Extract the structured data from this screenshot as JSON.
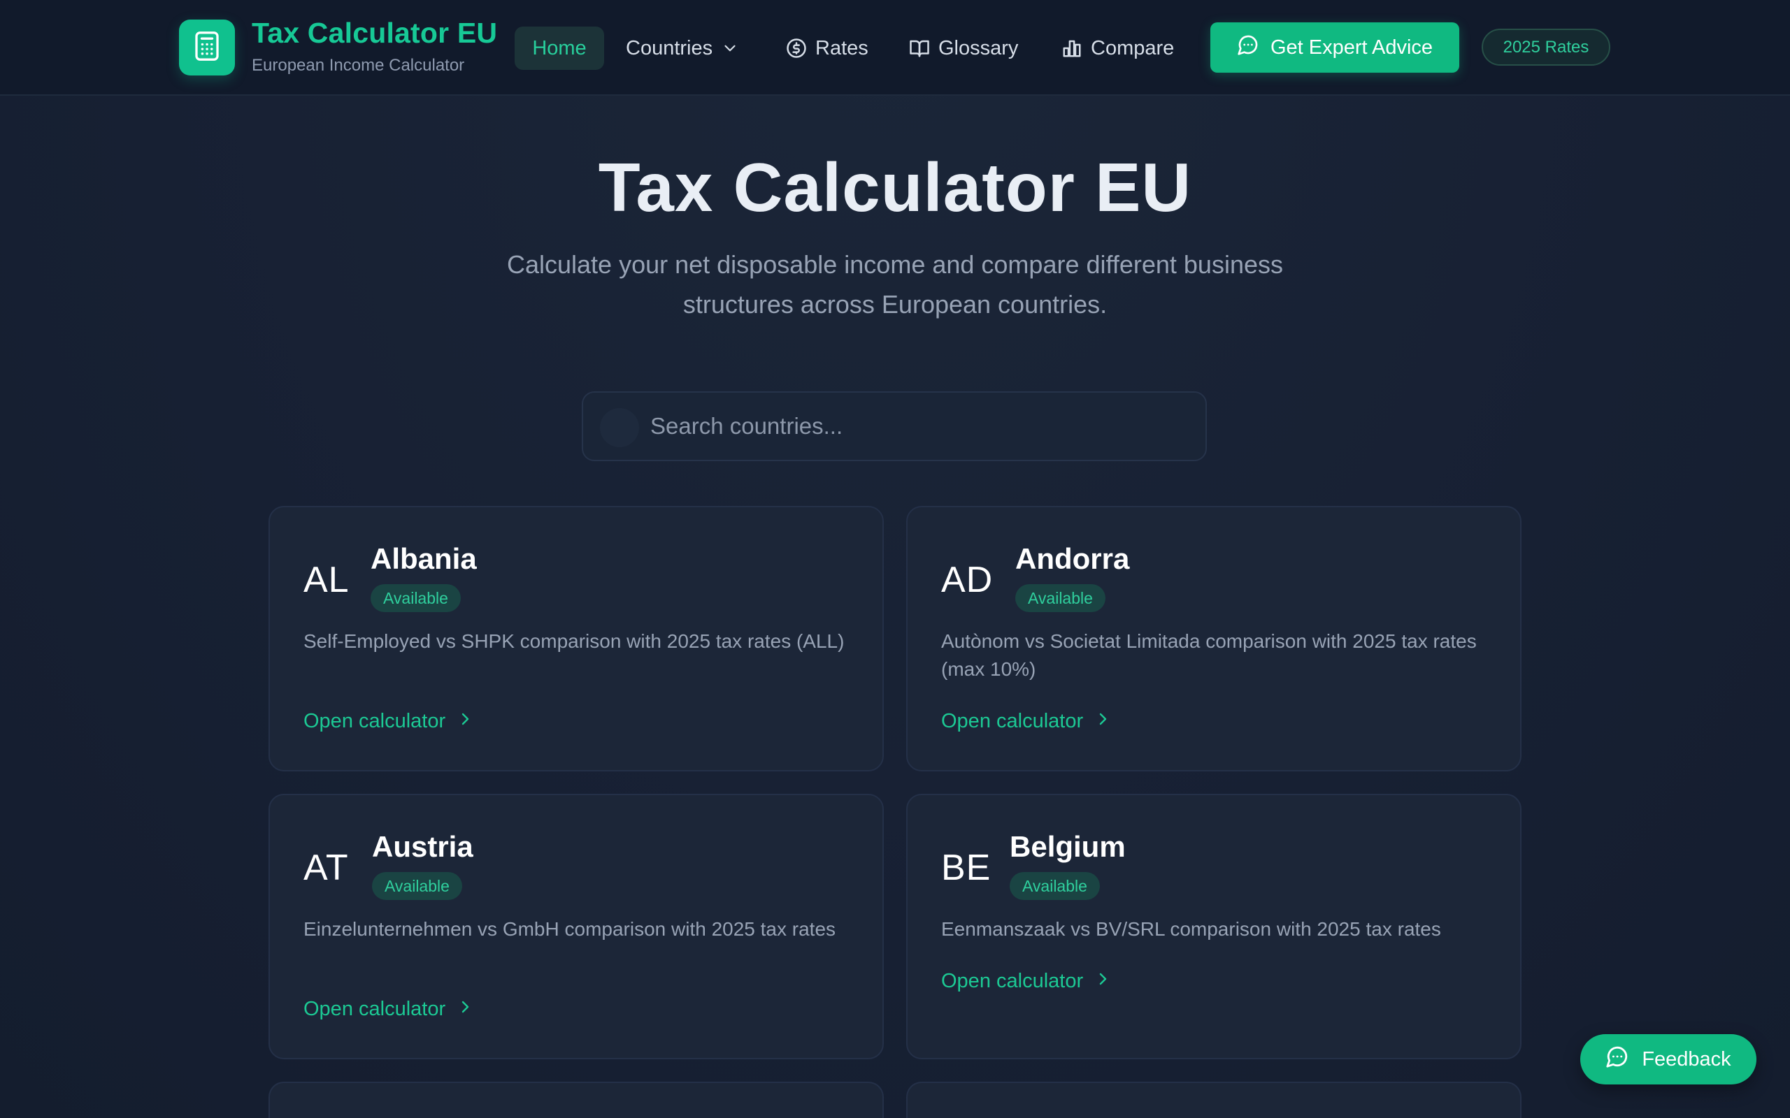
{
  "header": {
    "brand_title": "Tax Calculator EU",
    "brand_subtitle": "European Income Calculator",
    "nav": {
      "home": "Home",
      "countries": "Countries",
      "rates": "Rates",
      "glossary": "Glossary",
      "compare": "Compare"
    },
    "cta_label": "Get Expert Advice",
    "rates_badge": "2025 Rates"
  },
  "hero": {
    "title": "Tax Calculator EU",
    "subtitle": "Calculate your net disposable income and compare different business structures across European countries."
  },
  "search": {
    "placeholder": "Search countries..."
  },
  "countries": [
    {
      "code": "AL",
      "name": "Albania",
      "status": "Available",
      "description": "Self-Employed vs SHPK comparison with 2025 tax rates (ALL)",
      "link": "Open calculator"
    },
    {
      "code": "AD",
      "name": "Andorra",
      "status": "Available",
      "description": "Autònom vs Societat Limitada comparison with 2025 tax rates (max 10%)",
      "link": "Open calculator"
    },
    {
      "code": "AT",
      "name": "Austria",
      "status": "Available",
      "description": "Einzelunternehmen vs GmbH comparison with 2025 tax rates",
      "link": "Open calculator"
    },
    {
      "code": "BE",
      "name": "Belgium",
      "status": "Available",
      "description": "Eenmanszaak vs BV/SRL comparison with 2025 tax rates",
      "link": "Open calculator"
    }
  ],
  "feedback_label": "Feedback",
  "icons": {
    "logo": "calculator-icon",
    "countries": "chevron-down-icon",
    "rates": "dollar-circle-icon",
    "glossary": "book-icon",
    "compare": "bar-chart-icon",
    "cta": "chat-bubble-icon",
    "card_link": "chevron-right-icon",
    "feedback": "chat-bubble-icon"
  },
  "colors": {
    "accent": "#10b981",
    "accent_text": "#1cc994",
    "background": "#172033",
    "header_background": "#111a2b",
    "card_background": "#1c2638"
  }
}
